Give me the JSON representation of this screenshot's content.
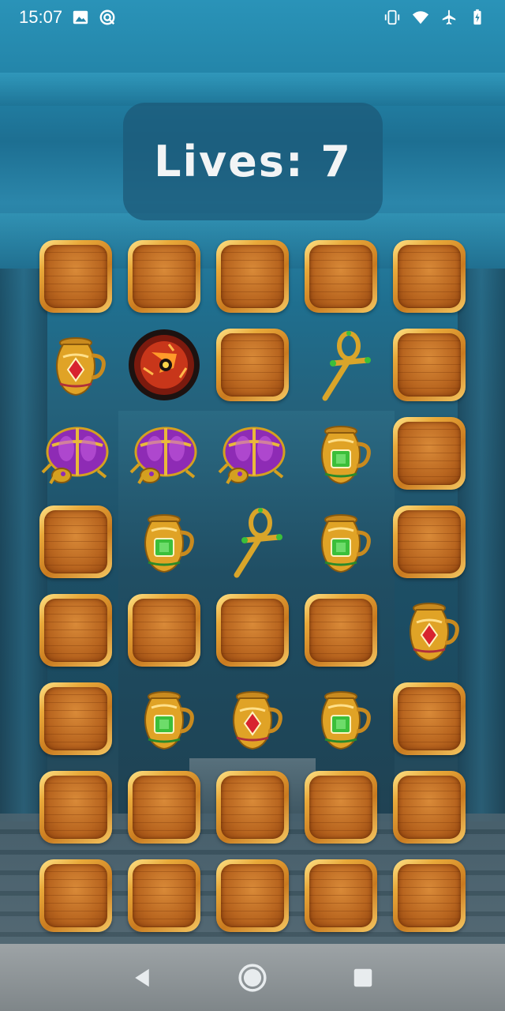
{
  "status_bar": {
    "time": "15:07",
    "left_icons": [
      "image-icon",
      "sync-icon"
    ],
    "right_icons": [
      "vibrate-icon",
      "wifi-icon",
      "airplane-icon",
      "battery-charging-icon"
    ]
  },
  "hud": {
    "lives_text": "Lives: 7"
  },
  "board": {
    "columns": 5,
    "rows": 8,
    "cells": [
      [
        "hidden",
        "hidden",
        "hidden",
        "hidden",
        "hidden"
      ],
      [
        "ruby-vase",
        "lava-bomb",
        "hidden",
        "ankh",
        "hidden"
      ],
      [
        "scarab",
        "scarab",
        "scarab",
        "emerald-vase",
        "hidden"
      ],
      [
        "hidden",
        "emerald-vase",
        "ankh",
        "emerald-vase",
        "hidden"
      ],
      [
        "hidden",
        "hidden",
        "hidden",
        "hidden",
        "ruby-vase"
      ],
      [
        "hidden",
        "emerald-vase",
        "ruby-vase",
        "emerald-vase",
        "hidden"
      ],
      [
        "hidden",
        "hidden",
        "hidden",
        "hidden",
        "hidden"
      ],
      [
        "hidden",
        "hidden",
        "hidden",
        "hidden",
        "hidden"
      ]
    ]
  },
  "colors": {
    "tile_gold": "#e9a93a",
    "tile_wood": "#b8651f",
    "panel_bg": "#1c5a78",
    "scarab_purple": "#8e2bb5",
    "ruby_red": "#d8232f",
    "emerald_green": "#3bbf3a"
  },
  "nav_bar": {
    "buttons": [
      "back-icon",
      "home-icon",
      "recents-icon"
    ]
  }
}
